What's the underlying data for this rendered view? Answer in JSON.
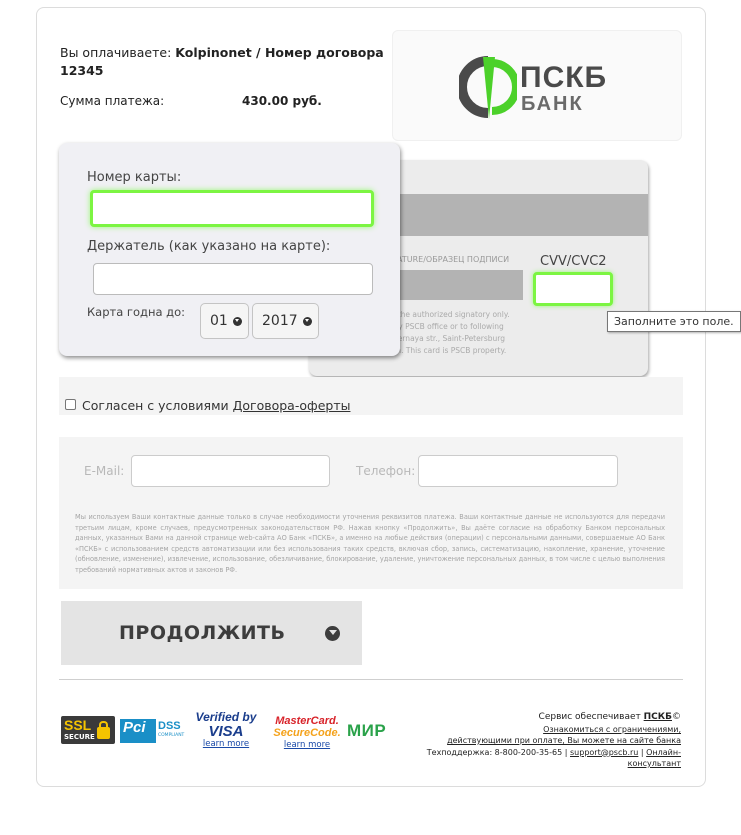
{
  "payment": {
    "prefix": "Вы оплачиваете:",
    "merchant": "Kolpinonet / Номер договора 12345",
    "sum_label": "Сумма платежа:",
    "sum_value": "430.00 руб."
  },
  "bank_logo": {
    "line1": "ПСКБ",
    "line2": "БАНК",
    "colors": {
      "green": "#4cd12a",
      "gray": "#4a4a4a"
    }
  },
  "card_front": {
    "number_label": "Номер карты:",
    "number_value": "",
    "holder_label": "Держатель (как указано на карте):",
    "holder_value": "",
    "expiry_label": "Карта годна до:",
    "expiry_month": "01",
    "expiry_year": "2017"
  },
  "card_back": {
    "signature_label": "ATURE/ОБРАЗЕЦ ПОДПИСИ",
    "cvv_label": "CVV/CVC2",
    "cvv_value": "",
    "fine_print": [
      "d by the authorized signatory only.",
      "to any PSCB office or to following",
      "mpalernaya str., Saint-Petersburg",
      "ertain. This card is PSCB property."
    ]
  },
  "tooltip": "Заполните это поле.",
  "agreement": {
    "text": "Согласен с условиями",
    "link": "Договора-оферты",
    "checked": false
  },
  "contacts": {
    "email_label": "E-Mail:",
    "email_value": "",
    "phone_label": "Телефон:",
    "phone_value": "",
    "disclaimer": "Мы используем Ваши контактные данные только в случае необходимости уточнения реквизитов платежа. Ваши контактные данные не используются для передачи третьим лицам, кроме случаев, предусмотренных законодательством РФ. Нажав кнопку «Продолжить», Вы даёте согласие на обработку Банком персональных данных, указанных Вами на данной странице web-сайта АО Банк «ПСКБ», а именно на любые действия (операции) с персональными данными, совершаемые АО Банк «ПСКБ» с использованием средств автоматизации или без использования таких средств, включая сбор, запись, систематизацию, накопление, хранение, уточнение (обновление, изменение), извлечение, использование, обезличивание, блокирование, удаление, уничтожение персональных данных, в том числе с целью выполнения требований нормативных актов и законов РФ."
  },
  "continue_button": "ПРОДОЛЖИТЬ",
  "badges": {
    "ssl_top": "SSL",
    "ssl_bottom": "SECURE",
    "pci": "Pci",
    "dss": "DSS",
    "compliant": "COMPLIANT",
    "visa_top": "Verified by",
    "visa_bottom": "VISA",
    "visa_learn": "learn more",
    "mc_top": "MasterCard.",
    "mc_bottom": "SecureCode.",
    "mc_learn": "learn more",
    "mir": "МИР"
  },
  "footer_info": {
    "service_prefix": "Сервис обеспечивает",
    "service_bank": "ПСКБ",
    "restrictions_1": "Ознакомиться с ограничениями,",
    "restrictions_2": "действующими при оплате, Вы можете на сайте банка",
    "support_prefix": "Техподдержка: 8-800-200-35-65 |",
    "support_email": "support@pscb.ru",
    "support_sep": "|",
    "support_chat": "Онлайн-консультант"
  }
}
